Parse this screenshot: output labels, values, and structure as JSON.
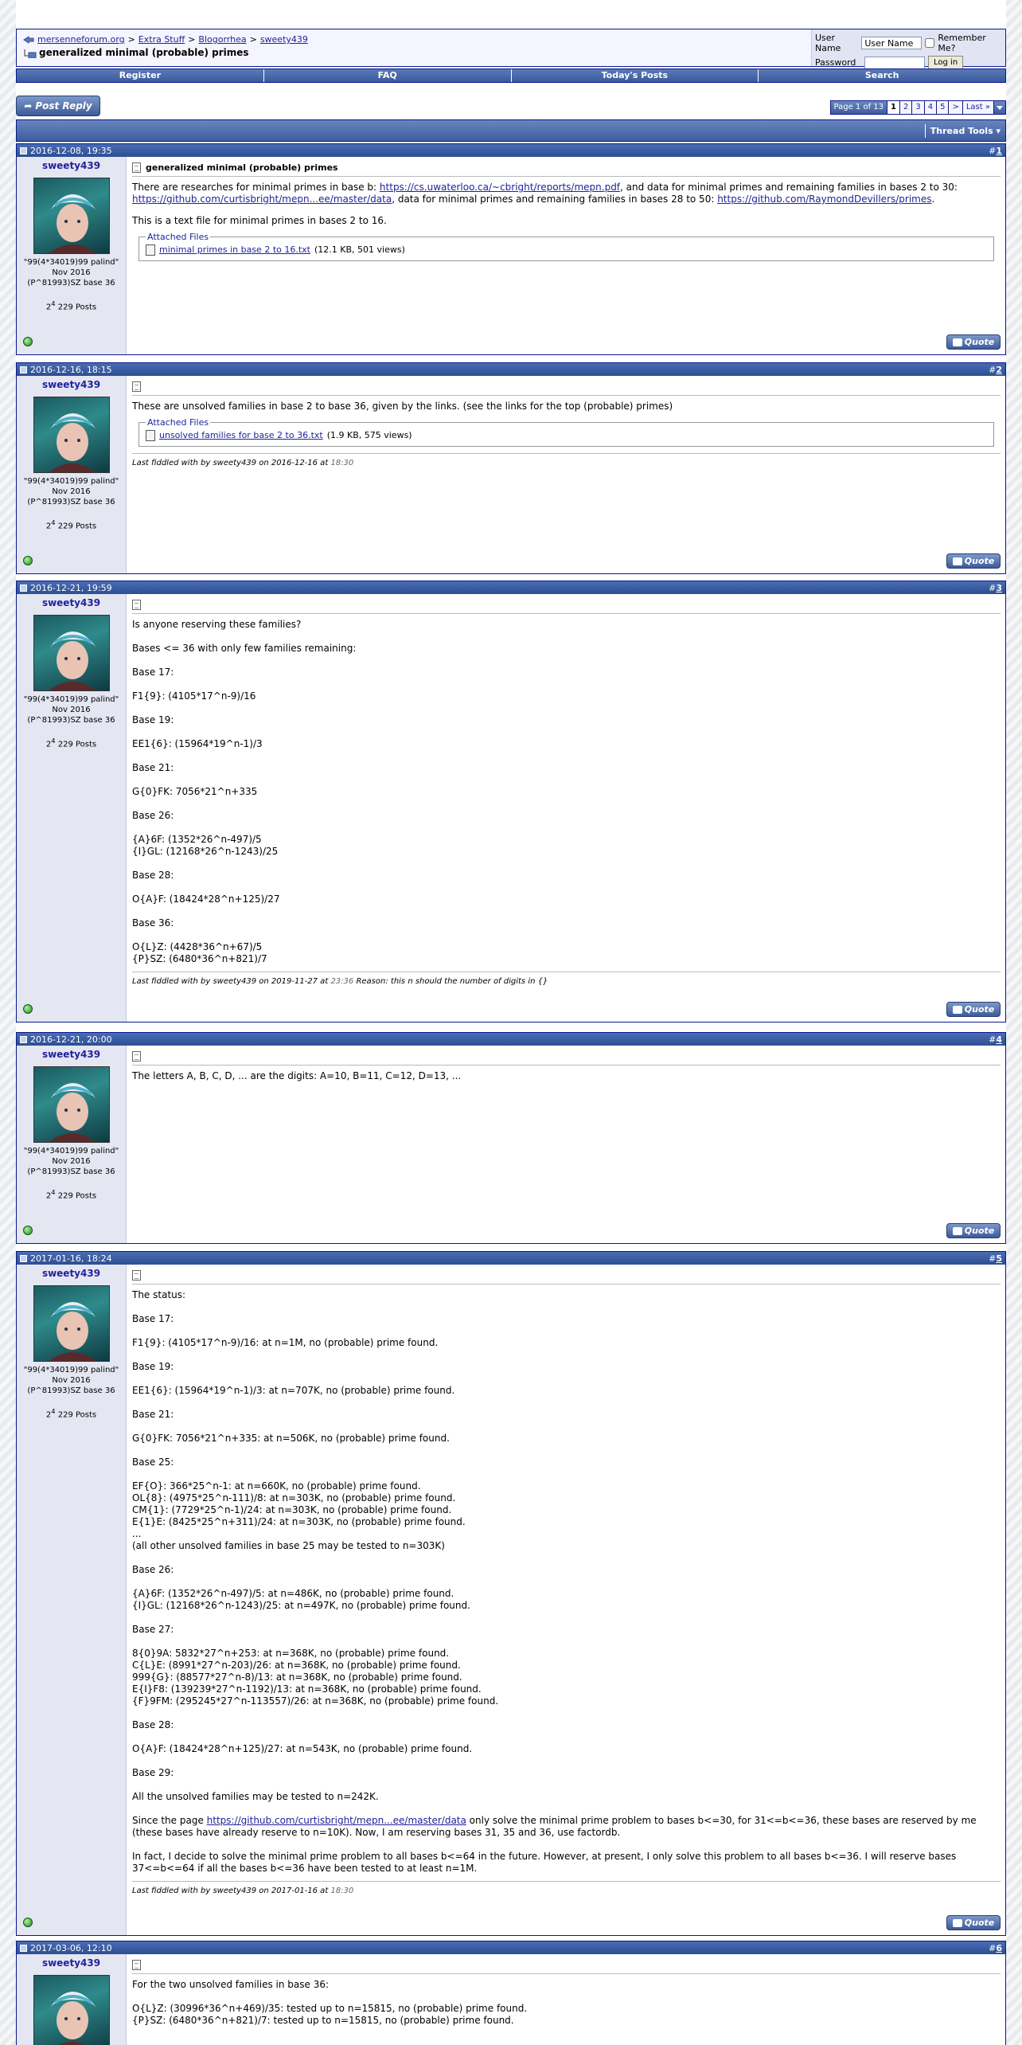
{
  "breadcrumb": {
    "root": "mersenneforum.org",
    "sep": ">",
    "items": [
      "Extra Stuff",
      "Blogorrhea",
      "sweety439"
    ]
  },
  "thread_title": "generalized minimal (probable) primes",
  "login": {
    "username_label": "User Name",
    "username_value": "User Name",
    "remember_label": "Remember Me?",
    "password_label": "Password",
    "login_button": "Log in"
  },
  "menu": [
    "Register",
    "FAQ",
    "Today's Posts",
    "Search"
  ],
  "post_reply_label": "Post Reply",
  "pagination": {
    "label": "Page 1 of 13",
    "pages": [
      "1",
      "2",
      "3",
      "4",
      "5"
    ],
    "next": ">",
    "last": "Last »"
  },
  "thread_tools_label": "Thread Tools",
  "user": {
    "name": "sweety439",
    "title": "\"99(4*34019)99 palind\"",
    "join": "Nov 2016",
    "extra": "(P^81993)SZ base 36",
    "posts_base": "2",
    "posts_exp": "4",
    "posts_rest": "229 Posts"
  },
  "quote_label": "Quote",
  "posts": [
    {
      "date": "2016-12-08, 19:35",
      "num": "1",
      "title": "generalized minimal (probable) primes",
      "body1_a": "There are researches for minimal primes in base b: ",
      "link1": "https://cs.uwaterloo.ca/~cbright/reports/mepn.pdf",
      "body1_b": ", and data for minimal primes and remaining families in bases 2 to 30: ",
      "link2": "https://github.com/curtisbright/mepn...ee/master/data",
      "body1_c": ", data for minimal primes and remaining families in bases 28 to 50: ",
      "link3": "https://github.com/RaymondDevillers/primes",
      "body1_d": ".",
      "body2": "This is a text file for minimal primes in bases 2 to 16.",
      "attach_legend": "Attached Files",
      "file": "minimal primes in base 2 to 16.txt",
      "file_info": "(12.1 KB, 501 views)"
    },
    {
      "date": "2016-12-16, 18:15",
      "num": "2",
      "body": "These are unsolved families in base 2 to base 36, given by the links. (see the links for the top (probable) primes)",
      "attach_legend": "Attached Files",
      "file": "unsolved families for base 2 to 36.txt",
      "file_info": "(1.9 KB, 575 views)",
      "edit": "Last fiddled with by sweety439 on 2016-12-16 at",
      "edit_time": "18:30"
    },
    {
      "date": "2016-12-21, 19:59",
      "num": "3",
      "lines": [
        "Is anyone reserving these families?",
        "",
        "Bases <= 36 with only few families remaining:",
        "",
        "Base 17:",
        "",
        "F1{9}: (4105*17^n-9)/16",
        "",
        "Base 19:",
        "",
        "EE1{6}: (15964*19^n-1)/3",
        "",
        "Base 21:",
        "",
        "G{0}FK: 7056*21^n+335",
        "",
        "Base 26:",
        "",
        "{A}6F: (1352*26^n-497)/5",
        "{I}GL: (12168*26^n-1243)/25",
        "",
        "Base 28:",
        "",
        "O{A}F: (18424*28^n+125)/27",
        "",
        "Base 36:",
        "",
        "O{L}Z: (4428*36^n+67)/5",
        "{P}SZ: (6480*36^n+821)/7"
      ],
      "edit": "Last fiddled with by sweety439 on 2019-11-27 at",
      "edit_time": "23:36",
      "edit_reason": "Reason: this n should the number of digits in {}"
    },
    {
      "date": "2016-12-21, 20:00",
      "num": "4",
      "body": "The letters A, B, C, D, ... are the digits: A=10, B=11, C=12, D=13, ..."
    },
    {
      "date": "2017-01-16, 18:24",
      "num": "5",
      "lines": [
        "The status:",
        "",
        "Base 17:",
        "",
        "F1{9}: (4105*17^n-9)/16: at n=1M, no (probable) prime found.",
        "",
        "Base 19:",
        "",
        "EE1{6}: (15964*19^n-1)/3: at n=707K, no (probable) prime found.",
        "",
        "Base 21:",
        "",
        "G{0}FK: 7056*21^n+335: at n=506K, no (probable) prime found.",
        "",
        "Base 25:",
        "",
        "EF{O}: 366*25^n-1: at n=660K, no (probable) prime found.",
        "OL{8}: (4975*25^n-111)/8: at n=303K, no (probable) prime found.",
        "CM{1}: (7729*25^n-1)/24: at n=303K, no (probable) prime found.",
        "E{1}E: (8425*25^n+311)/24: at n=303K, no (probable) prime found.",
        "...",
        "(all other unsolved families in base 25 may be tested to n=303K)",
        "",
        "Base 26:",
        "",
        "{A}6F: (1352*26^n-497)/5: at n=486K, no (probable) prime found.",
        "{I}GL: (12168*26^n-1243)/25: at n=497K, no (probable) prime found.",
        "",
        "Base 27:",
        "",
        "8{0}9A: 5832*27^n+253: at n=368K, no (probable) prime found.",
        "C{L}E: (8991*27^n-203)/26: at n=368K, no (probable) prime found.",
        "999{G}: (88577*27^n-8)/13: at n=368K, no (probable) prime found.",
        "E{I}F8: (139239*27^n-1192)/13: at n=368K, no (probable) prime found.",
        "{F}9FM: (295245*27^n-113557)/26: at n=368K, no (probable) prime found.",
        "",
        "Base 28:",
        "",
        "O{A}F: (18424*28^n+125)/27: at n=543K, no (probable) prime found.",
        "",
        "Base 29:",
        "",
        "All the unsolved families may be tested to n=242K.",
        ""
      ],
      "p_since_a": "Since the page ",
      "p_since_link": "https://github.com/curtisbright/mepn...ee/master/data",
      "p_since_b": " only solve the minimal prime problem to bases b<=30, for 31<=b<=36, these bases are reserved by me (these bases have already reserve to n=10K). Now, I am reserving bases 31, 35 and 36, use factordb.",
      "p_fact": "In fact, I decide to solve the minimal prime problem to all bases b<=64 in the future. However, at present, I only solve this problem to all bases b<=36. I will reserve bases 37<=b<=64 if all the bases b<=36 have been tested to at least n=1M.",
      "edit": "Last fiddled with by sweety439 on 2017-01-16 at",
      "edit_time": "18:30"
    },
    {
      "date": "2017-03-06, 12:10",
      "num": "6",
      "lines": [
        "For the two unsolved families in base 36:",
        "",
        "O{L}Z: (30996*36^n+469)/35: tested up to n=15815, no (probable) prime found.",
        "{P}SZ: (6480*36^n+821)/7: tested up to n=15815, no (probable) prime found."
      ]
    }
  ]
}
